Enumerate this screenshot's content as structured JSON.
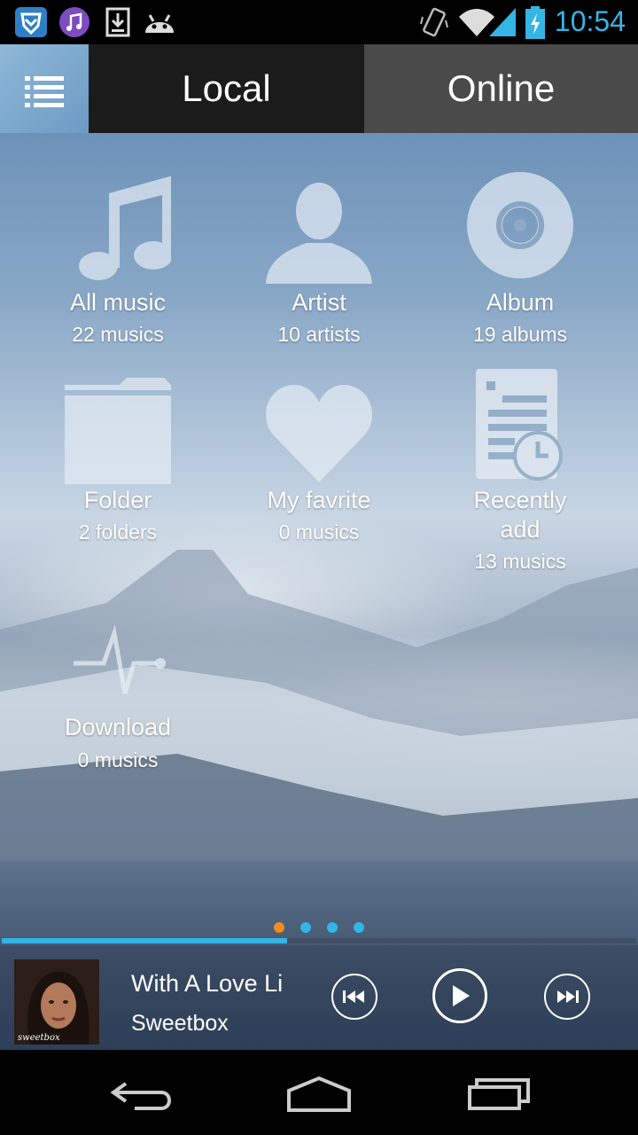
{
  "status_bar": {
    "time": "10:54",
    "icons": [
      "shield-app-icon",
      "music-app-icon",
      "download-icon",
      "android-icon",
      "vibrate-icon",
      "wifi-icon",
      "signal-icon",
      "battery-charging-icon"
    ]
  },
  "tabs": {
    "menu_icon": "list-menu-icon",
    "local_label": "Local",
    "online_label": "Online",
    "active": "Local"
  },
  "categories": [
    {
      "title": "All music",
      "subtitle": "22 musics",
      "icon": "music-note-icon"
    },
    {
      "title": "Artist",
      "subtitle": "10 artists",
      "icon": "person-icon"
    },
    {
      "title": "Album",
      "subtitle": "19 albums",
      "icon": "disc-icon"
    },
    {
      "title": "Folder",
      "subtitle": "2 folders",
      "icon": "folder-icon"
    },
    {
      "title": "My favrite",
      "subtitle": "0 musics",
      "icon": "heart-icon"
    },
    {
      "title": "Recently\nadd",
      "subtitle": "13 musics",
      "icon": "recent-document-icon"
    },
    {
      "title": "Download",
      "subtitle": "0 musics",
      "icon": "pulse-icon"
    }
  ],
  "pager": {
    "count": 4,
    "active_index": 0,
    "active_color": "#f28c1c",
    "inactive_color": "#33b5e5"
  },
  "player": {
    "song_title": "With A Love Li",
    "artist": "Sweetbox",
    "cover_text": "sweetbox",
    "progress": 0.45,
    "accent": "#33b5e5"
  },
  "nav_bar": {
    "icons": [
      "back-icon",
      "home-icon",
      "recent-apps-icon"
    ]
  }
}
